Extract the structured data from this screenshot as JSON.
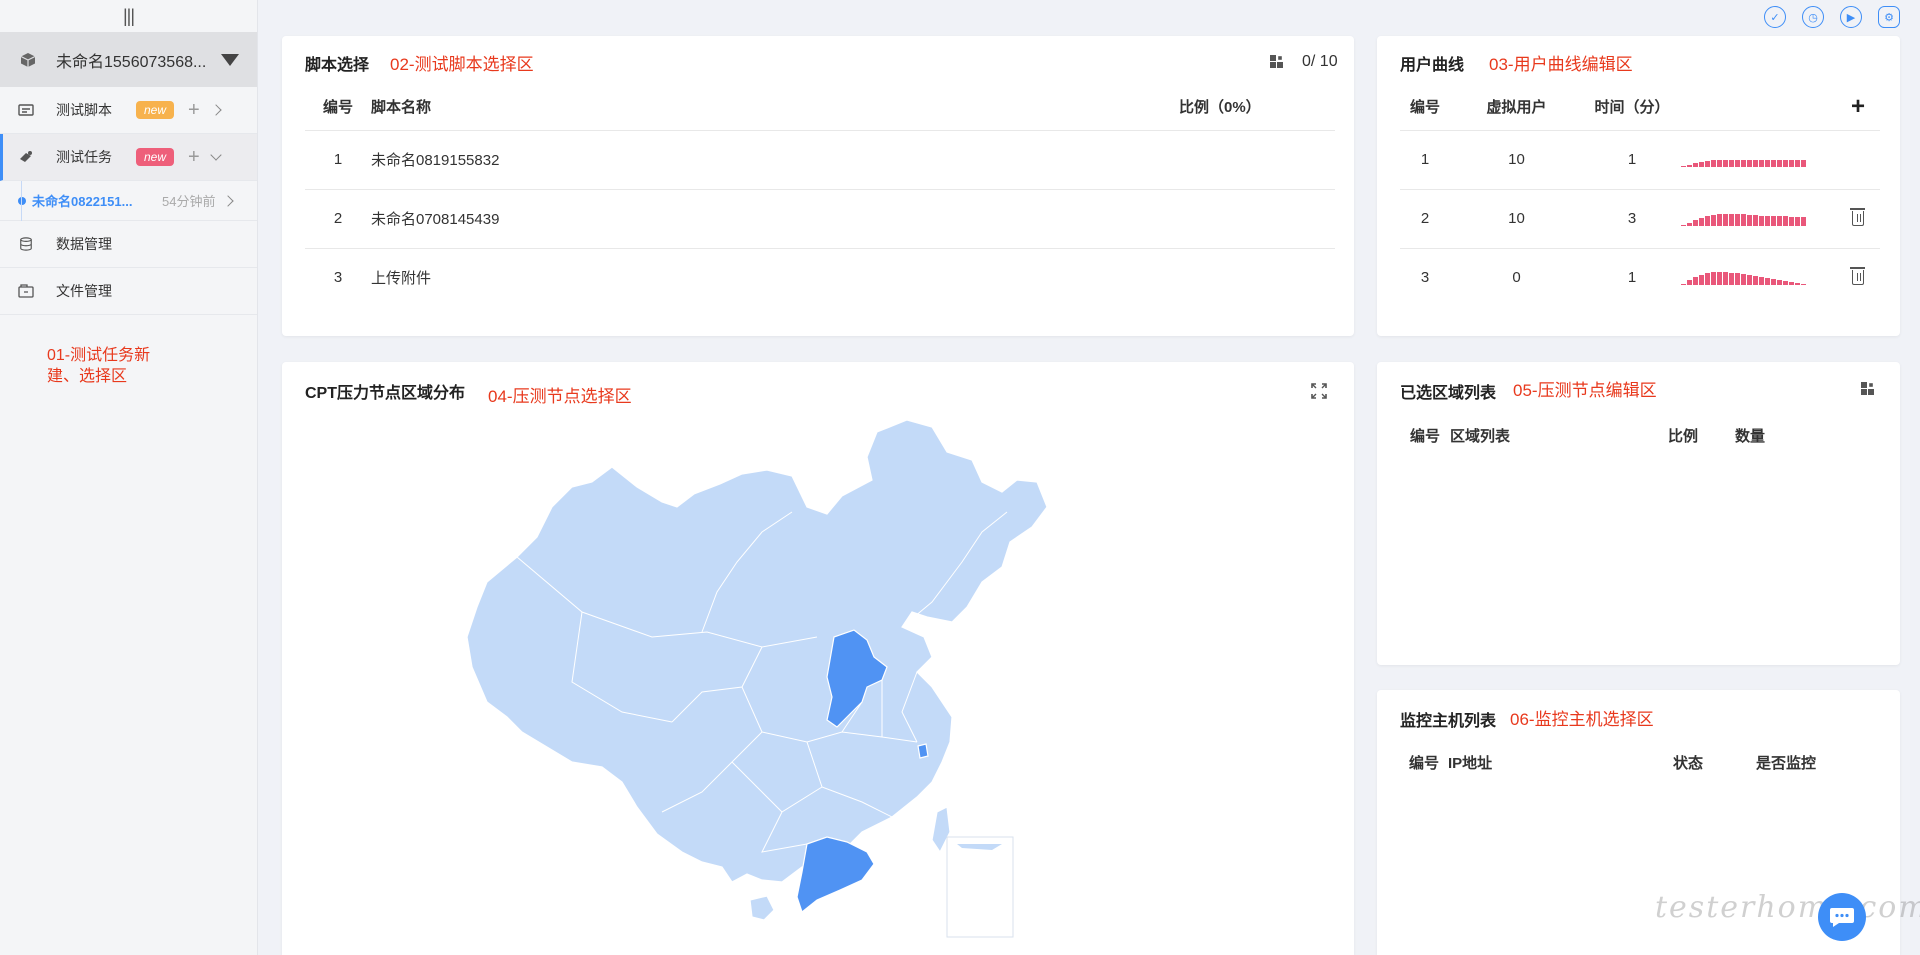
{
  "sidebar": {
    "handle_icon": "three-bars-icon",
    "project_name": "未命名1556073568...",
    "items": [
      {
        "label": "测试脚本",
        "badge": "new",
        "badge_color": "#f7b24d"
      },
      {
        "label": "测试任务",
        "badge": "new",
        "badge_color": "#ee5f7a"
      },
      {
        "label": "数据管理"
      },
      {
        "label": "文件管理"
      }
    ],
    "task": {
      "name": "未命名0822151...",
      "time": "54分钟前"
    },
    "annotation_line1": "01-测试任务新",
    "annotation_line2": "建、选择区"
  },
  "script_panel": {
    "title": "脚本选择",
    "annotation": "02-测试脚本选择区",
    "count": "0/ 10",
    "headers": [
      "编号",
      "脚本名称",
      "比例（0%）"
    ],
    "rows": [
      {
        "no": "1",
        "name": "未命名0819155832"
      },
      {
        "no": "2",
        "name": "未命名0708145439"
      },
      {
        "no": "3",
        "name": "上传附件"
      }
    ]
  },
  "curve_panel": {
    "title": "用户曲线",
    "annotation": "03-用户曲线编辑区",
    "headers": [
      "编号",
      "虚拟用户",
      "时间（分）"
    ],
    "add_label": "+",
    "rows": [
      {
        "no": "1",
        "users": "10",
        "time": "1"
      },
      {
        "no": "2",
        "users": "10",
        "time": "3"
      },
      {
        "no": "3",
        "users": "0",
        "time": "1"
      }
    ]
  },
  "map_panel": {
    "title": "CPT压力节点区域分布",
    "annotation": "04-压测节点选择区",
    "base_color": "#c3daf8",
    "selected_color": "#5093f3"
  },
  "region_panel": {
    "title": "已选区域列表",
    "annotation": "05-压测节点编辑区",
    "headers": [
      "编号",
      "区域列表",
      "比例",
      "数量"
    ]
  },
  "monitor_panel": {
    "title": "监控主机列表",
    "annotation": "06-监控主机选择区",
    "headers": [
      "编号",
      "IP地址",
      "状态",
      "是否监控"
    ]
  },
  "top_icons": [
    "check-circle-icon",
    "clock-icon",
    "play-circle-icon",
    "settings-icon"
  ],
  "watermark": "testerhome.com",
  "accent": "#3e8ef7",
  "annotation_color": "#e8391d"
}
